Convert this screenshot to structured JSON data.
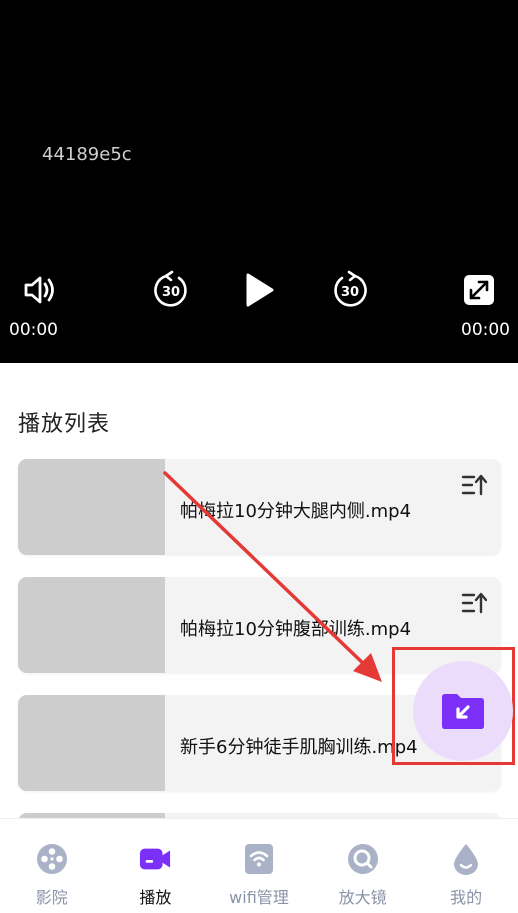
{
  "player": {
    "video_id": "44189e5c",
    "current_time": "00:00",
    "total_time": "00:00",
    "rewind_seconds": "30",
    "forward_seconds": "30",
    "icons": [
      "volume-icon",
      "rewind-30-icon",
      "play-icon",
      "forward-30-icon",
      "fullscreen-icon"
    ]
  },
  "playlist": {
    "title": "播放列表",
    "items": [
      {
        "name": "帕梅拉10分钟大腿内侧.mp4"
      },
      {
        "name": "帕梅拉10分钟腹部训练.mp4"
      },
      {
        "name": "新手6分钟徒手肌胸训练.mp4"
      },
      {
        "name": ""
      }
    ]
  },
  "import_button": {
    "icon": "folder-import-icon",
    "accent": "#7b2ff7"
  },
  "annotation": {
    "color": "#e53935"
  },
  "bottom_nav": {
    "items": [
      {
        "label": "影院",
        "icon": "film-reel-icon"
      },
      {
        "label": "播放",
        "icon": "video-camera-icon",
        "active": true
      },
      {
        "label": "wifi管理",
        "icon": "wifi-icon"
      },
      {
        "label": "放大镜",
        "icon": "magnifier-icon"
      },
      {
        "label": "我的",
        "icon": "drop-icon"
      }
    ]
  }
}
